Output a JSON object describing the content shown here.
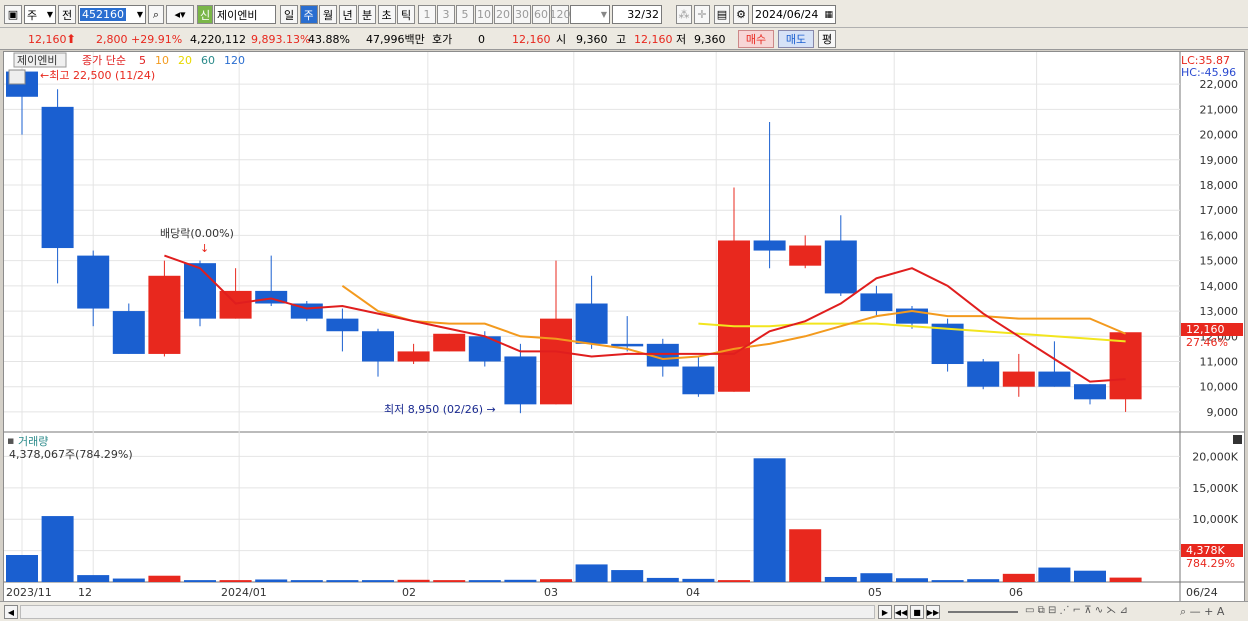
{
  "toolbar": {
    "market": "주",
    "prev": "전",
    "code": "452160",
    "badge": "신",
    "stock_name": "제이엔비",
    "periods": [
      "일",
      "주",
      "월",
      "년",
      "분",
      "초",
      "틱"
    ],
    "active_period": 1,
    "minutes": [
      "1",
      "3",
      "5",
      "10",
      "20",
      "30",
      "60",
      "120"
    ],
    "count": "32",
    "count_total": "/32",
    "date": "2024/06/24"
  },
  "quote": {
    "price": "12,160",
    "change": "2,800 +29.91%",
    "volume": "4,220,112",
    "vol_ratio": "9,893.13%",
    "turnover": "43.88%",
    "amount": "47,996백만",
    "hoga_label": "호가",
    "hoga_value": "0",
    "hoga_price": "12,160",
    "open_label": "시",
    "open": "9,360",
    "high_label": "고",
    "high": "12,160",
    "low_label": "저",
    "low": "9,360",
    "buy_label": "매수",
    "sell_label": "매도",
    "eval_label": "평"
  },
  "price_panel": {
    "legend_name": "제이엔비",
    "legend_ma": "종가 단순",
    "ma_periods": [
      "5",
      "10",
      "20",
      "60",
      "120"
    ],
    "lc": "LC:35.87",
    "hc": "HC:-45.96",
    "y_ticks": [
      "22,000",
      "21,000",
      "20,000",
      "19,000",
      "18,000",
      "17,000",
      "16,000",
      "15,000",
      "14,000",
      "13,000",
      "12,000",
      "11,000",
      "10,000",
      "9,000"
    ],
    "high_note": "←최고 22,500 (11/24)",
    "low_note": "최저 8,950 (02/26) →",
    "dividend_note": "배당락(0.00%)",
    "last_price_tag": "12,160",
    "last_pct_tag": "27.46%"
  },
  "volume_panel": {
    "title": "거래량",
    "summary": "4,378,067주(784.29%)",
    "y_ticks": [
      "20,000K",
      "15,000K",
      "10,000K",
      "5,000K"
    ],
    "last_vol_tag": "4,378K",
    "last_pct_tag": "784.29%"
  },
  "x_labels": [
    "2023/11",
    "12",
    "2024/01",
    "02",
    "03",
    "04",
    "05",
    "06",
    "06/24"
  ],
  "colors": {
    "up": "#e8281e",
    "down": "#1a5fd0",
    "ma5": "#e01e1e",
    "ma10": "#f39a1e",
    "ma20": "#f2e51e"
  },
  "chart_data": {
    "type": "candlestick",
    "ylim": [
      8600,
      22800
    ],
    "candles": [
      {
        "o": 22500,
        "h": 22500,
        "l": 20000,
        "c": 21500
      },
      {
        "o": 21100,
        "h": 21800,
        "l": 14100,
        "c": 15500
      },
      {
        "o": 15200,
        "h": 15400,
        "l": 12400,
        "c": 13100
      },
      {
        "o": 13000,
        "h": 13300,
        "l": 11300,
        "c": 11300
      },
      {
        "o": 11300,
        "h": 15000,
        "l": 11200,
        "c": 14400
      },
      {
        "o": 14900,
        "h": 15000,
        "l": 12400,
        "c": 12700
      },
      {
        "o": 12700,
        "h": 14700,
        "l": 12700,
        "c": 13800
      },
      {
        "o": 13800,
        "h": 15200,
        "l": 13200,
        "c": 13300
      },
      {
        "o": 13300,
        "h": 13400,
        "l": 12600,
        "c": 12700
      },
      {
        "o": 12700,
        "h": 13100,
        "l": 11400,
        "c": 12200
      },
      {
        "o": 12200,
        "h": 12300,
        "l": 10400,
        "c": 11000
      },
      {
        "o": 11000,
        "h": 11700,
        "l": 10900,
        "c": 11400
      },
      {
        "o": 11400,
        "h": 12100,
        "l": 11400,
        "c": 12100
      },
      {
        "o": 12000,
        "h": 12200,
        "l": 10800,
        "c": 11000
      },
      {
        "o": 11200,
        "h": 11700,
        "l": 8950,
        "c": 9300
      },
      {
        "o": 9300,
        "h": 15000,
        "l": 9300,
        "c": 12700
      },
      {
        "o": 13300,
        "h": 14400,
        "l": 11500,
        "c": 11700
      },
      {
        "o": 11700,
        "h": 12800,
        "l": 11400,
        "c": 11600
      },
      {
        "o": 11700,
        "h": 11900,
        "l": 10400,
        "c": 10800
      },
      {
        "o": 10800,
        "h": 11200,
        "l": 9600,
        "c": 9700
      },
      {
        "o": 9800,
        "h": 17900,
        "l": 9800,
        "c": 15800
      },
      {
        "o": 15800,
        "h": 20500,
        "l": 14700,
        "c": 15400
      },
      {
        "o": 14800,
        "h": 16000,
        "l": 14700,
        "c": 15600
      },
      {
        "o": 15800,
        "h": 16800,
        "l": 13600,
        "c": 13700
      },
      {
        "o": 13700,
        "h": 14000,
        "l": 12800,
        "c": 13000
      },
      {
        "o": 13100,
        "h": 13200,
        "l": 12300,
        "c": 12500
      },
      {
        "o": 12500,
        "h": 12700,
        "l": 10600,
        "c": 10900
      },
      {
        "o": 11000,
        "h": 11100,
        "l": 9900,
        "c": 10000
      },
      {
        "o": 10000,
        "h": 11300,
        "l": 9600,
        "c": 10600
      },
      {
        "o": 10600,
        "h": 11800,
        "l": 10000,
        "c": 10000
      },
      {
        "o": 10100,
        "h": 10100,
        "l": 9300,
        "c": 9500
      },
      {
        "o": 9500,
        "h": 12160,
        "l": 9000,
        "c": 12160
      }
    ],
    "ma5": [
      null,
      null,
      null,
      null,
      15200,
      14700,
      13300,
      13500,
      13100,
      13200,
      12900,
      12600,
      12300,
      12000,
      11400,
      11400,
      11200,
      11300,
      11300,
      11300,
      11300,
      12200,
      12600,
      13300,
      14300,
      14700,
      14000,
      12900,
      12000,
      11100,
      10200,
      10300
    ],
    "ma10": [
      null,
      null,
      null,
      null,
      null,
      null,
      null,
      null,
      null,
      14000,
      13000,
      12600,
      12500,
      12500,
      12000,
      11900,
      11700,
      11500,
      11100,
      11200,
      11500,
      11700,
      12000,
      12400,
      12800,
      13000,
      12800,
      12800,
      12700,
      12700,
      12700,
      12100
    ],
    "ma20": [
      null,
      null,
      null,
      null,
      null,
      null,
      null,
      null,
      null,
      null,
      null,
      null,
      null,
      null,
      null,
      null,
      null,
      null,
      null,
      12500,
      12400,
      12400,
      12500,
      12500,
      12500,
      12400,
      12300,
      12200,
      12100,
      12000,
      11900,
      11800
    ],
    "volumes_k": [
      4300,
      10500,
      1100,
      550,
      1000,
      300,
      300,
      400,
      300,
      300,
      300,
      350,
      300,
      300,
      350,
      450,
      2800,
      1900,
      650,
      500,
      300,
      19700,
      8400,
      800,
      1400,
      600,
      300,
      450,
      1300,
      2300,
      1800,
      700,
      4378
    ]
  }
}
